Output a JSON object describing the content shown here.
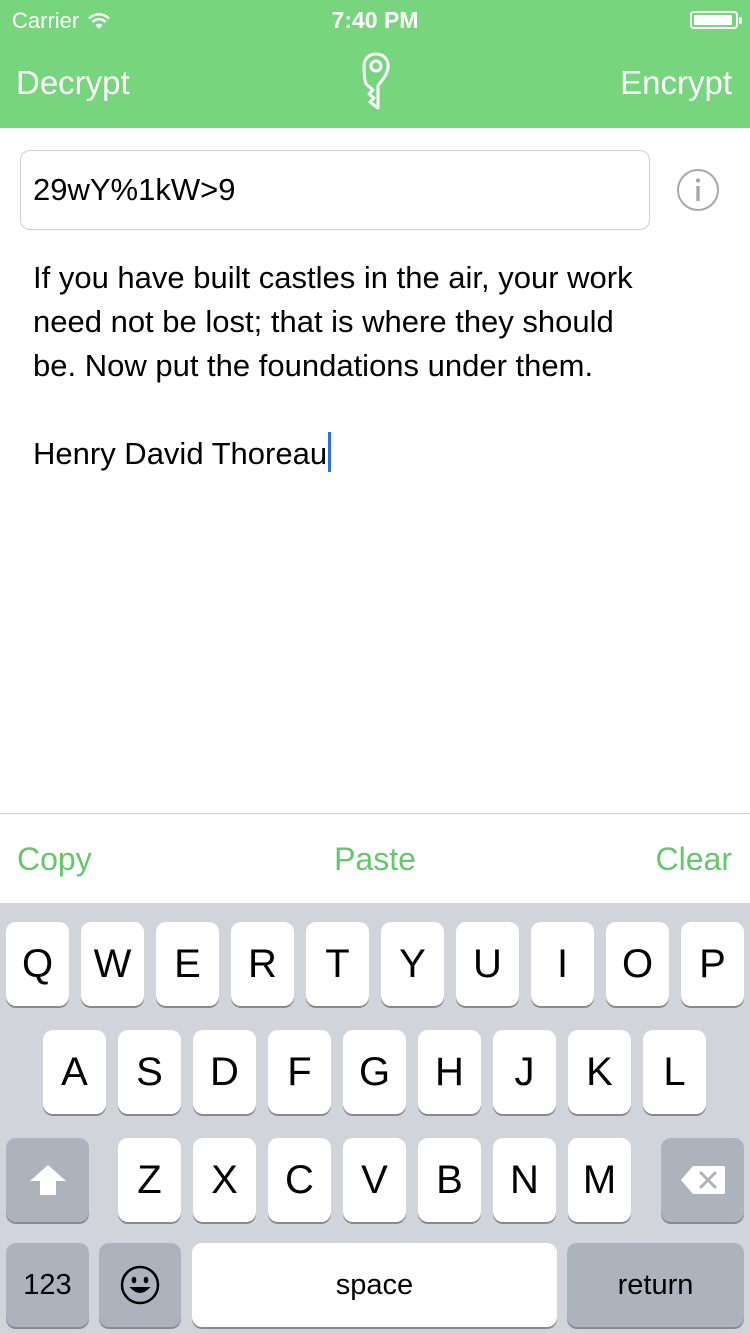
{
  "status_bar": {
    "carrier": "Carrier",
    "time": "7:40 PM"
  },
  "nav": {
    "left_label": "Decrypt",
    "right_label": "Encrypt",
    "logo_icon": "key-logo-icon"
  },
  "key_field": {
    "value": "29wY%1kW>9"
  },
  "message": {
    "lines": [
      "If you have built castles in the air, your work",
      "need not be lost; that is where they should",
      "be. Now put the foundations under them.",
      "",
      "Henry David Thoreau"
    ]
  },
  "actions": {
    "copy": "Copy",
    "paste": "Paste",
    "clear": "Clear"
  },
  "keyboard": {
    "row1": [
      "Q",
      "W",
      "E",
      "R",
      "T",
      "Y",
      "U",
      "I",
      "O",
      "P"
    ],
    "row2": [
      "A",
      "S",
      "D",
      "F",
      "G",
      "H",
      "J",
      "K",
      "L"
    ],
    "row3": [
      "Z",
      "X",
      "C",
      "V",
      "B",
      "N",
      "M"
    ],
    "numbers_label": "123",
    "space_label": "space",
    "return_label": "return",
    "shift_icon": "shift-icon",
    "delete_icon": "backspace-icon",
    "emoji_icon": "emoji-icon"
  },
  "colors": {
    "accent": "#76d57d",
    "action_text": "#63c86a",
    "caret": "#2f6de6",
    "keyboard_bg": "#d1d5db"
  }
}
